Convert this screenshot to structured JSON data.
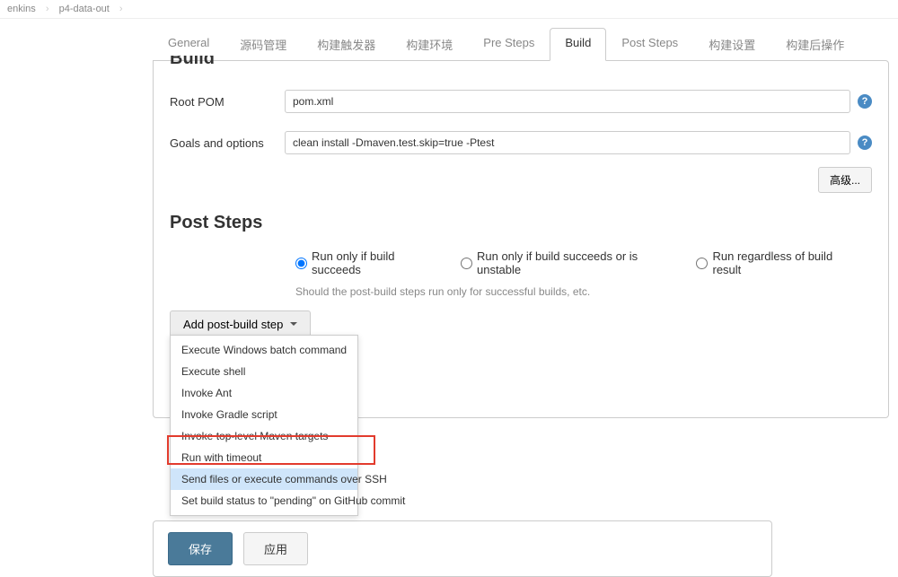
{
  "breadcrumb": {
    "seg1": "enkins",
    "seg2": "p4-data-out"
  },
  "tabs": {
    "general": "General",
    "source": "源码管理",
    "trigger": "构建触发器",
    "env": "构建环境",
    "presteps": "Pre Steps",
    "build": "Build",
    "poststeps": "Post Steps",
    "settings": "构建设置",
    "postop": "构建后操作"
  },
  "build": {
    "partial_title": "Build",
    "root_pom_label": "Root POM",
    "root_pom_value": "pom.xml",
    "goals_label": "Goals and options",
    "goals_value": "clean install -Dmaven.test.skip=true -Ptest",
    "advanced_label": "高级..."
  },
  "poststeps": {
    "title": "Post Steps",
    "radio1": "Run only if build succeeds",
    "radio2": "Run only if build succeeds or is unstable",
    "radio3": "Run regardless of build result",
    "hint": "Should the post-build steps run only for successful builds, etc.",
    "dropdown_label": "Add post-build step",
    "items": {
      "i0": "Execute Windows batch command",
      "i1": "Execute shell",
      "i2": "Invoke Ant",
      "i3": "Invoke Gradle script",
      "i4": "Invoke top-level Maven targets",
      "i5": "Run with timeout",
      "i6": "Send files or execute commands over SSH",
      "i7": "Set build status to \"pending\" on GitHub commit"
    }
  },
  "footer": {
    "save": "保存",
    "apply": "应用"
  }
}
